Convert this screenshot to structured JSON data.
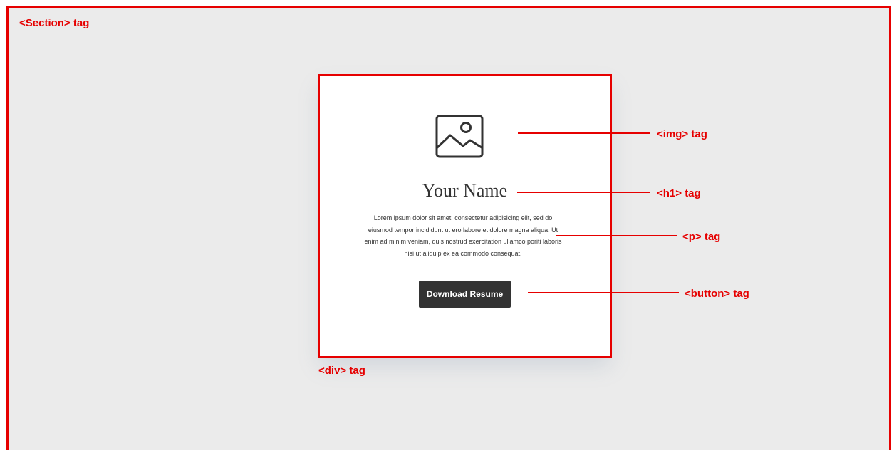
{
  "labels": {
    "section": "<Section> tag",
    "div": "<div> tag",
    "img": "<img> tag",
    "h1": "<h1> tag",
    "p": "<p> tag",
    "button": "<button> tag"
  },
  "card": {
    "image_icon": "image-placeholder-icon",
    "title": "Your Name",
    "paragraph": "Lorem ipsum dolor sit amet, consectetur adipisicing elit, sed do eiusmod tempor incididunt ut ero labore et dolore magna aliqua. Ut enim ad minim veniam, quis nostrud exercitation ullamco poriti laboris nisi ut aliquip ex ea commodo consequat.",
    "button_label": "Download Resume"
  },
  "colors": {
    "annotation": "#e60000",
    "section_background": "#ebebeb",
    "card_background": "#ffffff",
    "text": "#333333",
    "button_background": "#333333",
    "button_text": "#ffffff"
  }
}
